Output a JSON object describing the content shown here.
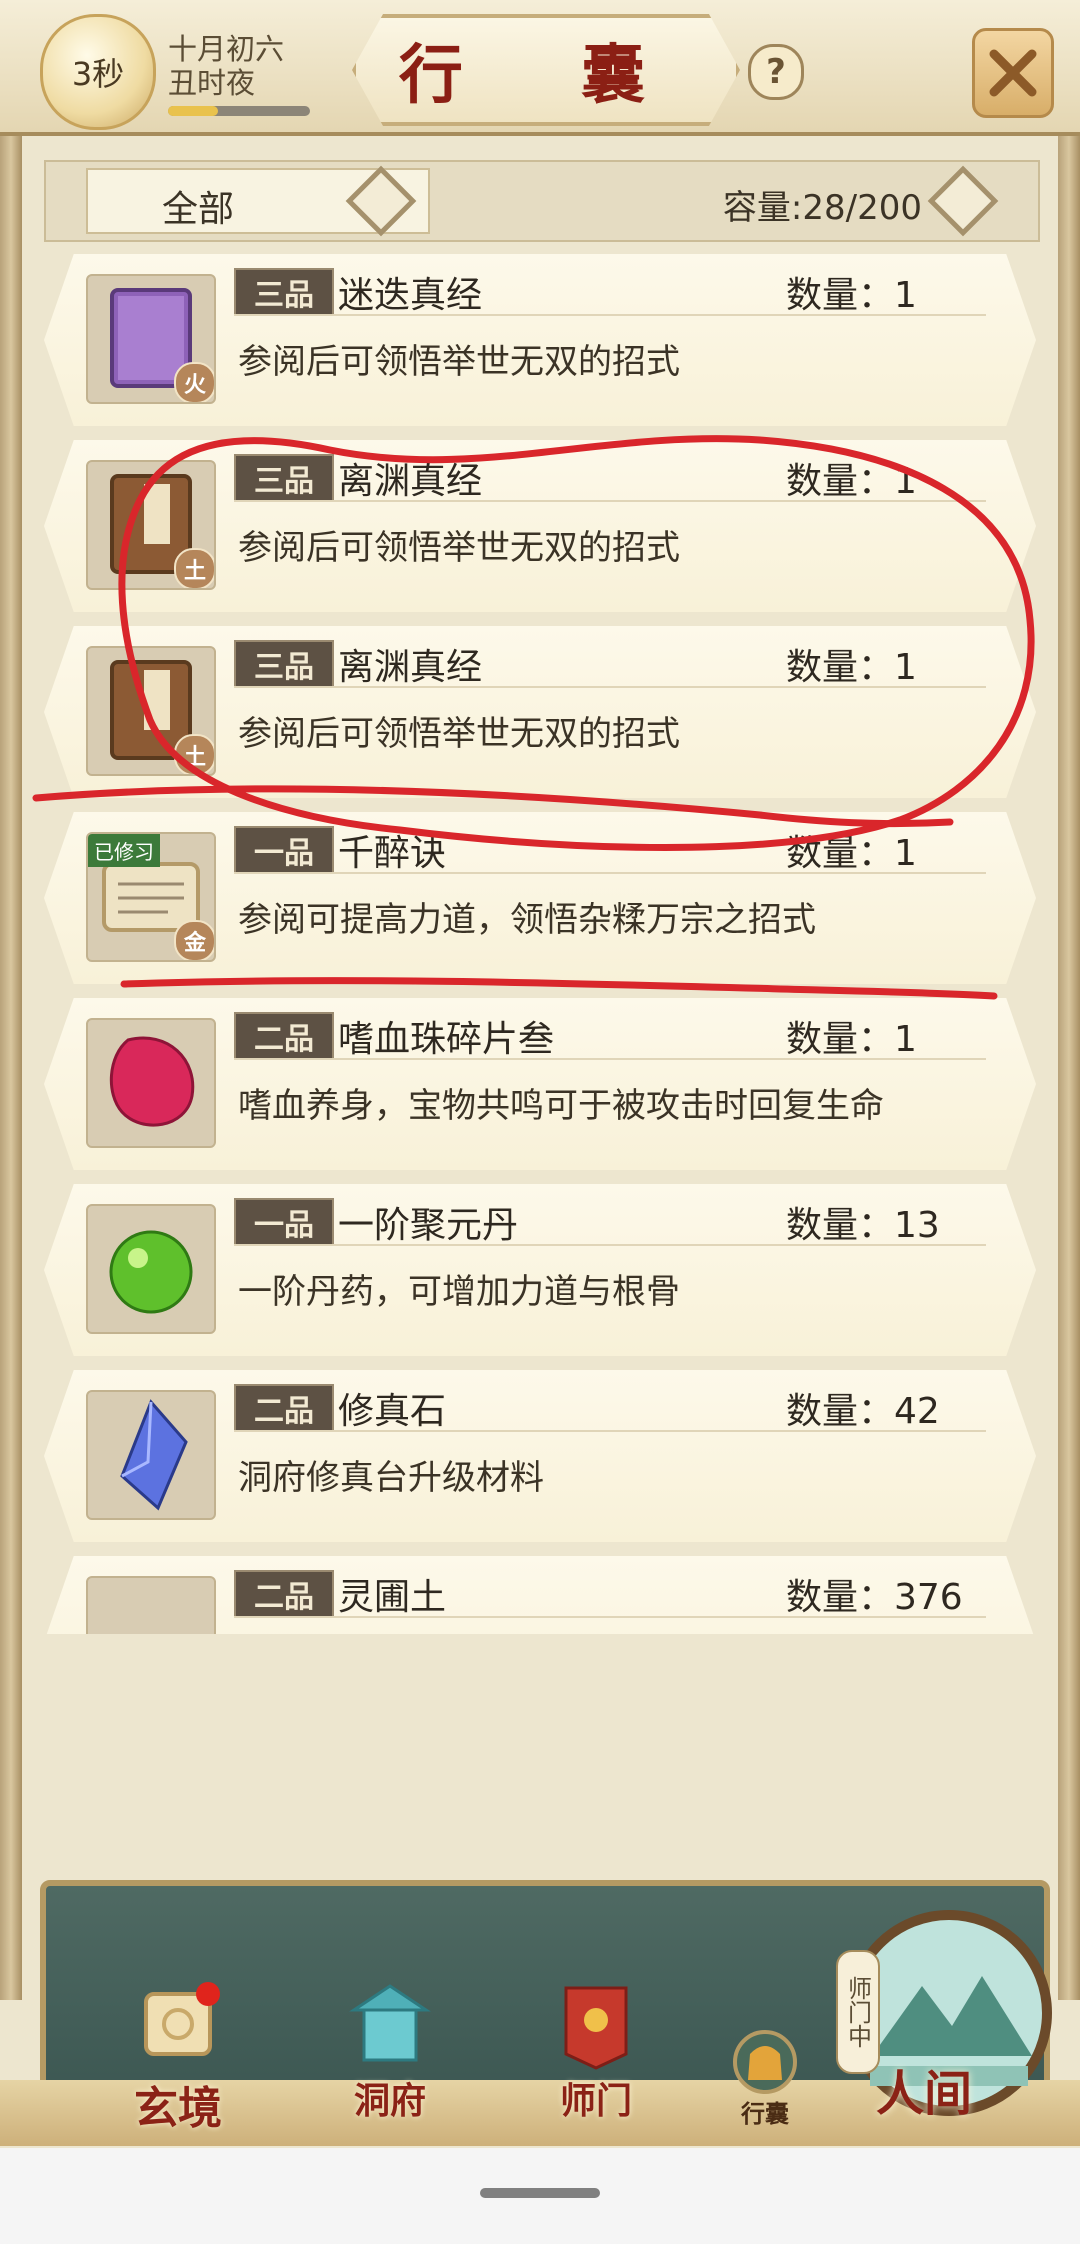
{
  "header": {
    "timer": "3秒",
    "date_line1": "十月初六",
    "date_line2": "丑时夜",
    "timer_progress_fraction": 0.35,
    "title": "行 囊",
    "help": "?",
    "close_icon": "close-x-icon"
  },
  "filter": {
    "selected": "全部",
    "capacity_label": "容量:28/200"
  },
  "items": [
    {
      "grade": "三品",
      "name": "迷迭真经",
      "qty": "数量：1",
      "desc": "参阅后可领悟举世无双的招式",
      "element": "火",
      "icon": "purple-book-icon",
      "studied": false
    },
    {
      "grade": "三品",
      "name": "离渊真经",
      "qty": "数量：1",
      "desc": "参阅后可领悟举世无双的招式",
      "element": "土",
      "icon": "brown-book-icon",
      "studied": false
    },
    {
      "grade": "三品",
      "name": "离渊真经",
      "qty": "数量：1",
      "desc": "参阅后可领悟举世无双的招式",
      "element": "土",
      "icon": "brown-book-icon",
      "studied": false
    },
    {
      "grade": "一品",
      "name": "千醉诀",
      "qty": "数量：1",
      "desc": "参阅可提高力道，领悟杂糅万宗之招式",
      "element": "金",
      "icon": "scroll-icon",
      "studied": true,
      "studied_label": "已修习"
    },
    {
      "grade": "二品",
      "name": "嗜血珠碎片叁",
      "qty": "数量：1",
      "desc": "嗜血养身，宝物共鸣可于被攻击时回复生命",
      "element": "",
      "icon": "red-gem-shard-icon",
      "studied": false
    },
    {
      "grade": "一品",
      "name": "一阶聚元丹",
      "qty": "数量：13",
      "desc": "一阶丹药，可增加力道与根骨",
      "element": "",
      "icon": "green-pill-icon",
      "studied": false
    },
    {
      "grade": "二品",
      "name": "修真石",
      "qty": "数量：42",
      "desc": "洞府修真台升级材料",
      "element": "",
      "icon": "blue-crystal-icon",
      "studied": false
    },
    {
      "grade": "二品",
      "name": "灵圃土",
      "qty": "数量：376",
      "desc": "",
      "element": "",
      "icon": "green-soil-icon",
      "studied": false
    }
  ],
  "nav": {
    "xuanjing": "玄境",
    "dongfu": "洞府",
    "shimen": "师门",
    "xingnang": "行囊",
    "shimen_status": "师门中",
    "renjian": "人间"
  },
  "colors": {
    "annotation_red": "#d9262b",
    "title_red": "#8b1f14",
    "grade_bg": "#5d5144"
  }
}
